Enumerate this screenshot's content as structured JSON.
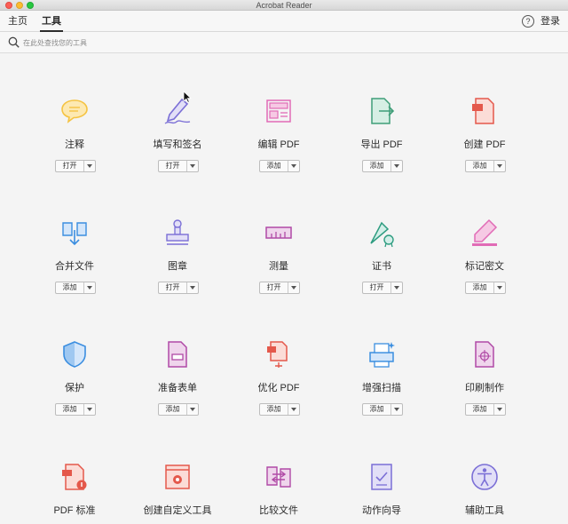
{
  "window": {
    "title": "Acrobat Reader"
  },
  "nav": {
    "home": "主页",
    "tools": "工具",
    "help_glyph": "?",
    "login": "登录"
  },
  "search": {
    "placeholder": "在此处查找您的工具"
  },
  "tools": [
    {
      "label": "注释",
      "button": "打开",
      "icon": "comment-icon",
      "color": "#f5c342"
    },
    {
      "label": "填写和签名",
      "button": "打开",
      "icon": "fill-sign-icon",
      "color": "#7b6fd6"
    },
    {
      "label": "编辑 PDF",
      "button": "添加",
      "icon": "edit-pdf-icon",
      "color": "#e16bb6"
    },
    {
      "label": "导出 PDF",
      "button": "添加",
      "icon": "export-pdf-icon",
      "color": "#3f9e78"
    },
    {
      "label": "创建 PDF",
      "button": "添加",
      "icon": "create-pdf-icon",
      "color": "#e4584b"
    },
    {
      "label": "合并文件",
      "button": "添加",
      "icon": "combine-files-icon",
      "color": "#3b8ee0"
    },
    {
      "label": "图章",
      "button": "打开",
      "icon": "stamp-icon",
      "color": "#7b6fd6"
    },
    {
      "label": "测量",
      "button": "打开",
      "icon": "measure-icon",
      "color": "#b04aa6"
    },
    {
      "label": "证书",
      "button": "打开",
      "icon": "certificate-icon",
      "color": "#2e9c80"
    },
    {
      "label": "标记密文",
      "button": "添加",
      "icon": "redact-icon",
      "color": "#e16bb6"
    },
    {
      "label": "保护",
      "button": "添加",
      "icon": "protect-icon",
      "color": "#3b8ee0"
    },
    {
      "label": "准备表单",
      "button": "添加",
      "icon": "prepare-form-icon",
      "color": "#b04aa6"
    },
    {
      "label": "优化 PDF",
      "button": "添加",
      "icon": "optimize-pdf-icon",
      "color": "#e4584b"
    },
    {
      "label": "增强扫描",
      "button": "添加",
      "icon": "enhance-scan-icon",
      "color": "#3b8ee0"
    },
    {
      "label": "印刷制作",
      "button": "添加",
      "icon": "print-production-icon",
      "color": "#b04aa6"
    },
    {
      "label": "PDF 标准",
      "button": "",
      "icon": "pdf-standards-icon",
      "color": "#e4584b"
    },
    {
      "label": "创建自定义工具",
      "button": "",
      "icon": "custom-tool-icon",
      "color": "#e4584b"
    },
    {
      "label": "比较文件",
      "button": "",
      "icon": "compare-files-icon",
      "color": "#b04aa6"
    },
    {
      "label": "动作向导",
      "button": "",
      "icon": "action-wizard-icon",
      "color": "#7b6fd6"
    },
    {
      "label": "辅助工具",
      "button": "",
      "icon": "accessibility-icon",
      "color": "#7b6fd6"
    }
  ]
}
